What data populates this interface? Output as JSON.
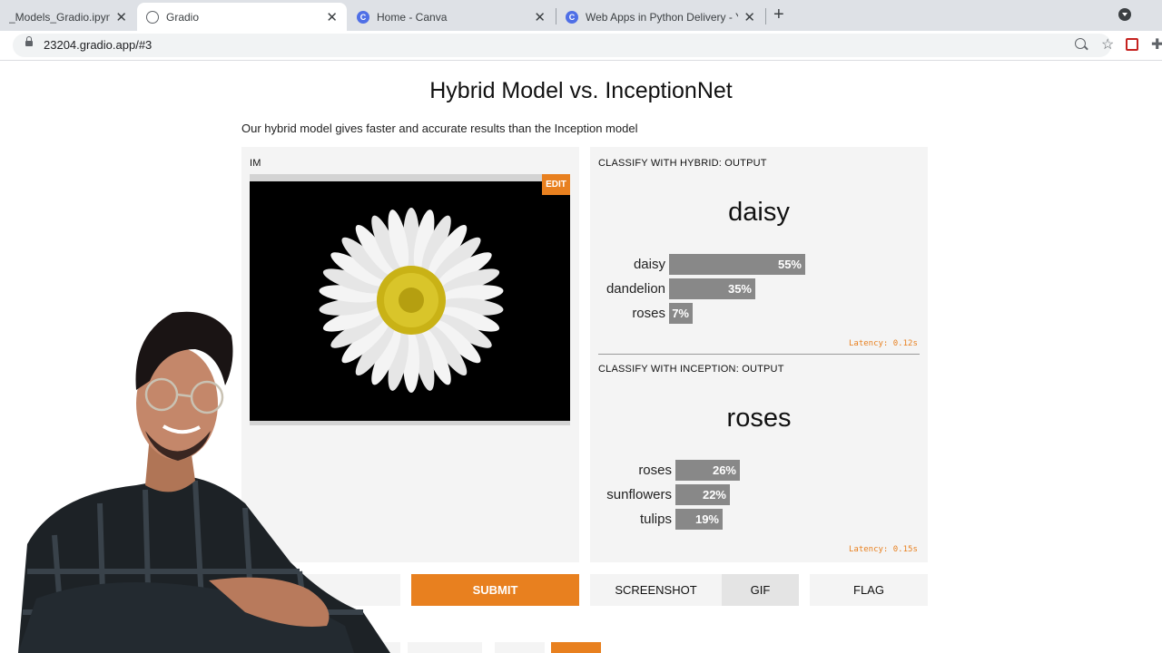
{
  "browser": {
    "tabs": [
      {
        "title": "_Models_Gradio.ipynb - ",
        "active": false
      },
      {
        "title": "Gradio",
        "active": true
      },
      {
        "title": "Home - Canva",
        "active": false
      },
      {
        "title": "Web Apps in Python Delivery - Yo",
        "active": false
      }
    ],
    "url": "23204.gradio.app/#3"
  },
  "app": {
    "title": "Hybrid Model vs. InceptionNet",
    "description": "Our hybrid model gives faster and accurate results than the Inception model",
    "input": {
      "label": "IM",
      "edit_label": "EDIT"
    },
    "outputs": [
      {
        "label": "CLASSIFY WITH HYBRID: OUTPUT",
        "prediction": "daisy",
        "confidences": [
          {
            "label": "daisy",
            "value": "55%",
            "fraction": 0.55
          },
          {
            "label": "dandelion",
            "value": "35%",
            "fraction": 0.35
          },
          {
            "label": "roses",
            "value": "7%",
            "fraction": 0.07
          }
        ],
        "latency": "Latency: 0.12s"
      },
      {
        "label": "CLASSIFY WITH INCEPTION: OUTPUT",
        "prediction": "roses",
        "confidences": [
          {
            "label": "roses",
            "value": "26%",
            "fraction": 0.26
          },
          {
            "label": "sunflowers",
            "value": "22%",
            "fraction": 0.22
          },
          {
            "label": "tulips",
            "value": "19%",
            "fraction": 0.19
          }
        ],
        "latency": "Latency: 0.15s"
      }
    ],
    "buttons": {
      "submit": "SUBMIT",
      "screenshot": "SCREENSHOT",
      "gif": "GIF",
      "flag": "FLAG"
    }
  },
  "colors": {
    "accent": "#e8801f",
    "bar": "#888888",
    "panel": "#f4f4f4"
  }
}
